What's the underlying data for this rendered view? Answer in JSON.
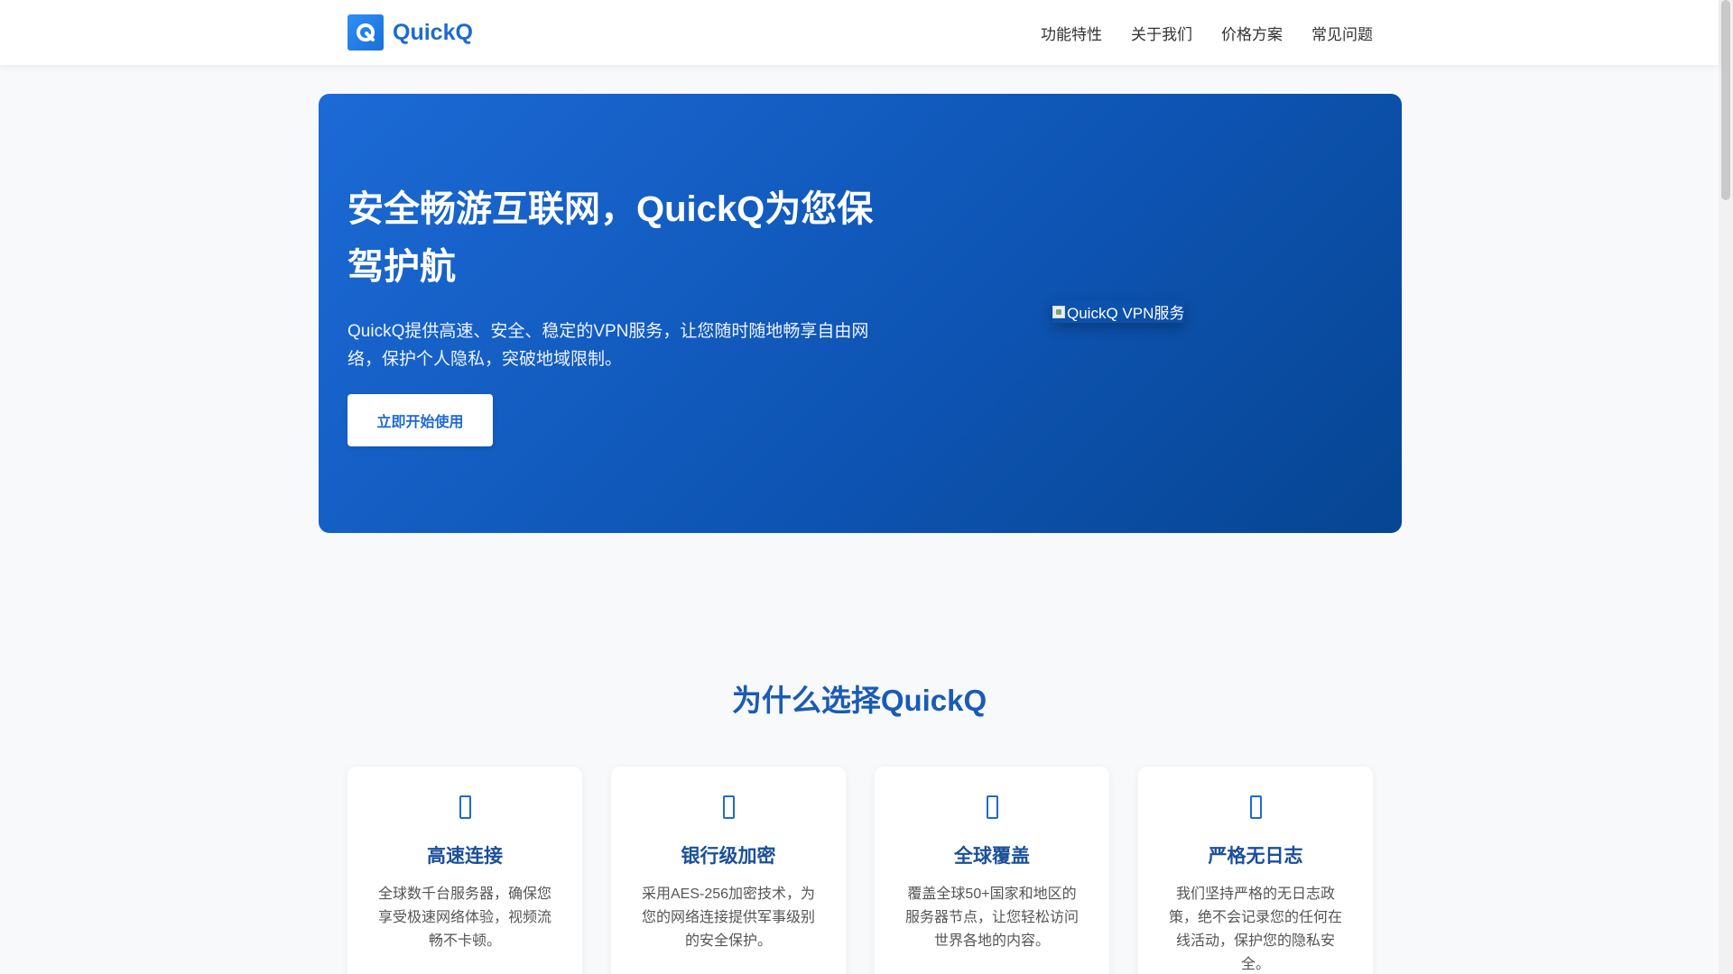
{
  "header": {
    "brand": "QuickQ",
    "nav": [
      {
        "label": "功能特性"
      },
      {
        "label": "关于我们"
      },
      {
        "label": "价格方案"
      },
      {
        "label": "常见问题"
      }
    ]
  },
  "hero": {
    "title": "安全畅游互联网，QuickQ为您保驾护航",
    "subtitle": "QuickQ提供高速、安全、稳定的VPN服务，让您随时随地畅享自由网络，保护个人隐私，突破地域限制。",
    "cta_label": "立即开始使用",
    "image_alt": "QuickQ VPN服务"
  },
  "features": {
    "title": "为什么选择QuickQ",
    "cards": [
      {
        "icon": "bolt-icon",
        "title": "高速连接",
        "desc": "全球数千台服务器，确保您享受极速网络体验，视频流畅不卡顿。"
      },
      {
        "icon": "lock-icon",
        "title": "银行级加密",
        "desc": "采用AES-256加密技术，为您的网络连接提供军事级别的安全保护。"
      },
      {
        "icon": "globe-icon",
        "title": "全球覆盖",
        "desc": "覆盖全球50+国家和地区的服务器节点，让您轻松访问世界各地的内容。"
      },
      {
        "icon": "shield-icon",
        "title": "严格无日志",
        "desc": "我们坚持严格的无日志政策，绝不会记录您的任何在线活动，保护您的隐私安全。"
      }
    ]
  },
  "colors": {
    "brand": "#1e6ad0",
    "hero_start": "#1c6ad6",
    "hero_end": "#064592"
  }
}
